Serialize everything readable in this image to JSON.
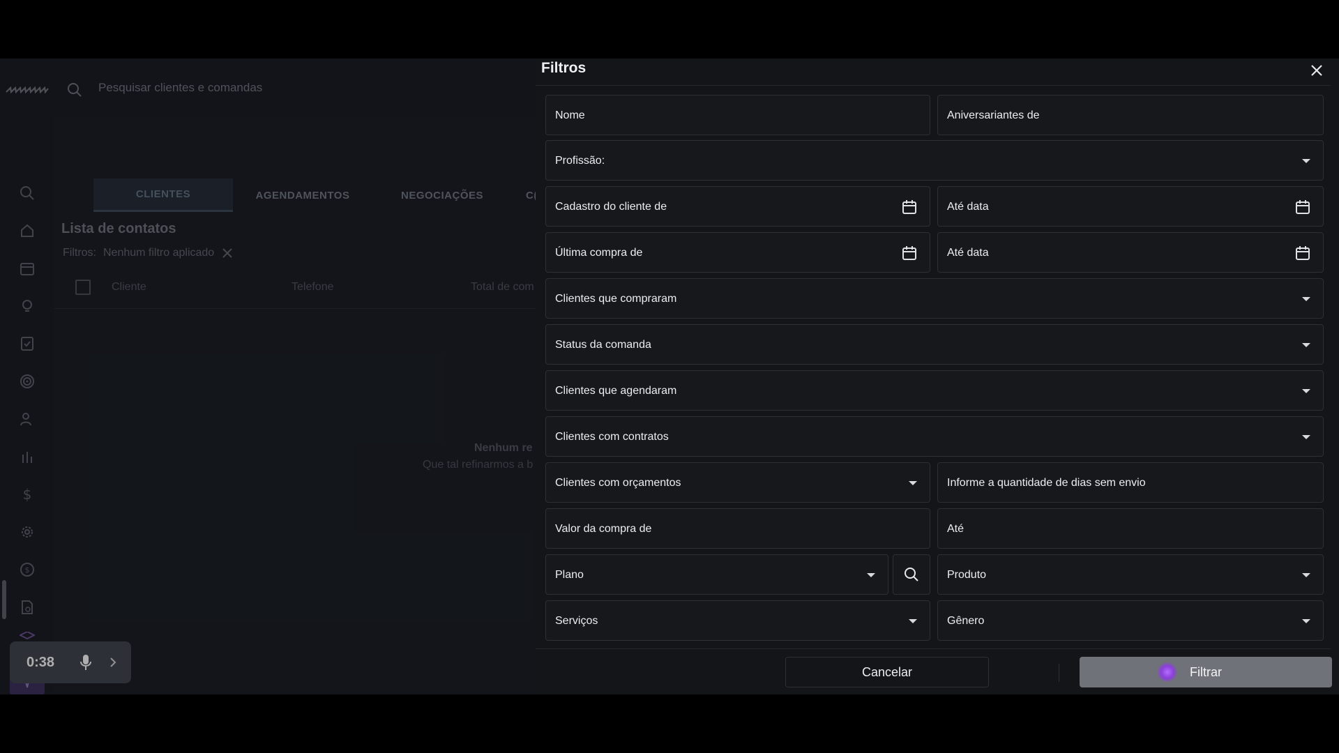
{
  "topbar": {
    "search_placeholder": "Pesquisar clientes e comandas"
  },
  "tabs": [
    "CLIENTES",
    "AGENDAMENTOS",
    "NEGOCIAÇÕES",
    "C("
  ],
  "list": {
    "title": "Lista de contatos",
    "filters_label": "Filtros:",
    "filters_value": "Nenhum filtro aplicado",
    "columns": [
      "Cliente",
      "Telefone",
      "Total de com"
    ],
    "empty_title": "Nenhum re",
    "empty_subtitle": "Que tal refinarmos a b"
  },
  "recorder": {
    "time": "0:38"
  },
  "filters_panel": {
    "title": "Filtros",
    "fields": {
      "nome": "Nome",
      "aniversariantes": "Aniversariantes de",
      "profissao": "Profissão:",
      "cadastro_de": "Cadastro do cliente de",
      "cadastro_ate": "Até data",
      "ultima_compra_de": "Última compra de",
      "ultima_compra_ate": "Até data",
      "compraram": "Clientes que compraram",
      "status_comanda": "Status da comanda",
      "agendaram": "Clientes que agendaram",
      "contratos": "Clientes com contratos",
      "orcamentos": "Clientes com orçamentos",
      "dias_sem_envio": "Informe a quantidade de dias sem envio",
      "valor_de": "Valor da compra de",
      "valor_ate": "Até",
      "plano": "Plano",
      "produto": "Produto",
      "servicos": "Serviços",
      "genero": "Gênero"
    },
    "cancel_label": "Cancelar",
    "filter_label": "Filtrar"
  },
  "colors": {
    "accent": "#3b3059",
    "panel_bg": "#141518",
    "app_bg": "#1b1e26"
  }
}
